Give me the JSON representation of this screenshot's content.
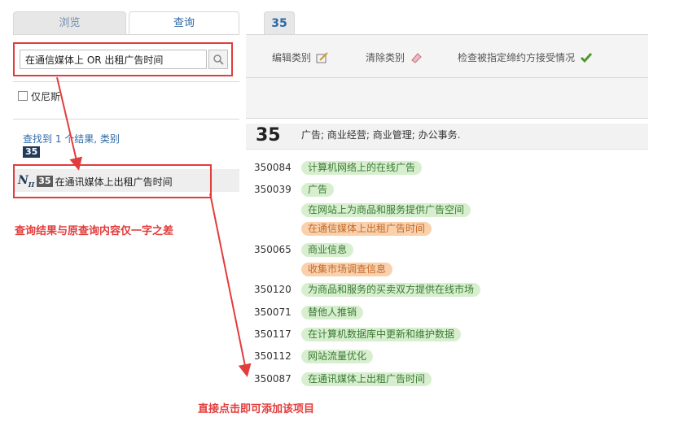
{
  "left": {
    "tabs": [
      {
        "label": "浏览"
      },
      {
        "label": "查询"
      }
    ],
    "search": {
      "value": "在通信媒体上 OR 出租广告时间"
    },
    "checkbox": {
      "label": "仅尼斯"
    },
    "results": {
      "summary": "查找到 1 个结果, 类别",
      "class": "35",
      "item": {
        "icon": "N",
        "icon_sub": "II",
        "class": "35",
        "text": "在通讯媒体上出租广告时间"
      }
    }
  },
  "annotations": {
    "note1": "查询结果与原查询内容仅一字之差",
    "note2": "直接点击即可添加该项目",
    "color": "#e23c3c"
  },
  "right": {
    "class_tab": "35",
    "toolbar": {
      "edit": "编辑类别",
      "clear": "清除类别",
      "check": "检查被指定缔约方接受情况"
    },
    "header": {
      "number": "35",
      "desc": "广告; 商业经营; 商业管理; 办公事务."
    },
    "entries": [
      {
        "code": "350084",
        "items": [
          {
            "text": "计算机网络上的在线广告",
            "color": "green"
          }
        ]
      },
      {
        "code": "350039",
        "items": [
          {
            "text": "广告",
            "color": "green"
          },
          {
            "text": "在网站上为商品和服务提供广告空间",
            "color": "green"
          },
          {
            "text": "在通信媒体上出租广告时间",
            "color": "orange"
          }
        ]
      },
      {
        "code": "350065",
        "items": [
          {
            "text": "商业信息",
            "color": "green"
          },
          {
            "text": "收集市场调查信息",
            "color": "orange"
          }
        ]
      },
      {
        "code": "350120",
        "items": [
          {
            "text": "为商品和服务的买卖双方提供在线市场",
            "color": "green"
          }
        ]
      },
      {
        "code": "350071",
        "items": [
          {
            "text": "替他人推销",
            "color": "green"
          }
        ]
      },
      {
        "code": "350117",
        "items": [
          {
            "text": "在计算机数据库中更新和维护数据",
            "color": "green"
          }
        ]
      },
      {
        "code": "350112",
        "items": [
          {
            "text": "网站流量优化",
            "color": "green"
          }
        ]
      },
      {
        "code": "350087",
        "items": [
          {
            "text": "在通讯媒体上出租广告时间",
            "color": "green"
          }
        ]
      }
    ]
  },
  "colors": {
    "accent_blue": "#2f6aa6",
    "pill_green": "#d7efcf",
    "pill_orange": "#f9d1ad"
  }
}
